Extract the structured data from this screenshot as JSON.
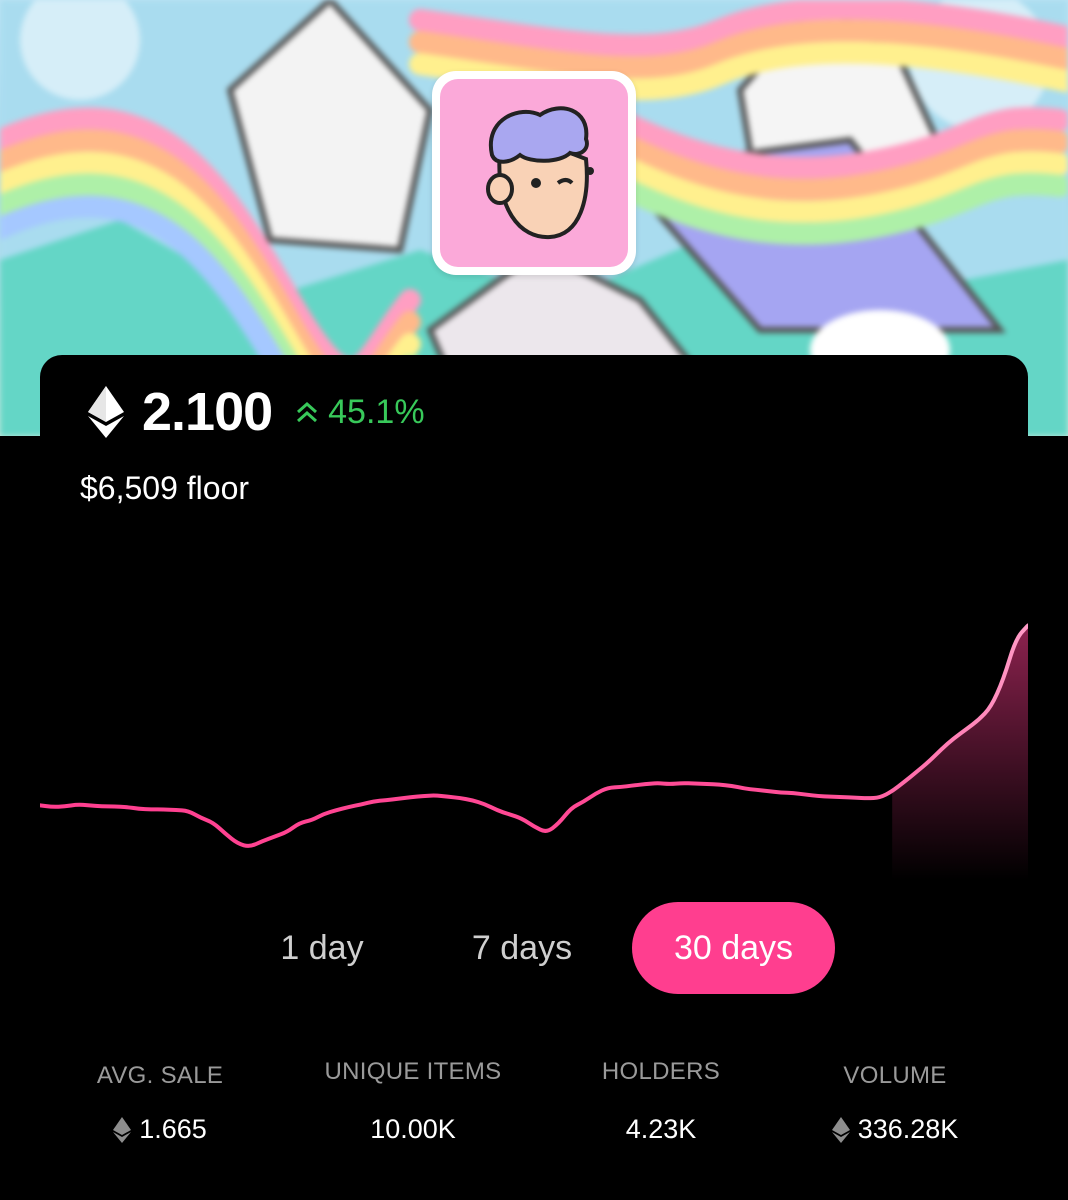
{
  "collection": {
    "avatar": "cartoon-boy-avatar",
    "banner": "rainbow-mountains-banner"
  },
  "price": {
    "currency_icon": "ethereum-icon",
    "floor_eth": "2.100",
    "change_icon": "double-chevron-up-icon",
    "change_pct": "45.1%",
    "floor_usd": "$6,509 floor"
  },
  "colors": {
    "accent": "#ff3e8f",
    "positive": "#38c95a",
    "line": "#ff5ea3"
  },
  "chart_data": {
    "type": "line",
    "title": "",
    "xlabel": "",
    "ylabel": "",
    "x": [
      0,
      1,
      2,
      3,
      4,
      5,
      6,
      7,
      8,
      9,
      10,
      11,
      12,
      13,
      14,
      15,
      16,
      17,
      18,
      19,
      20,
      21,
      22,
      23,
      24,
      25,
      26,
      27,
      28,
      29,
      30,
      31,
      32,
      33,
      34,
      35,
      36,
      37,
      38,
      39,
      40,
      41,
      42,
      43,
      44,
      45,
      46,
      47,
      48,
      49,
      50,
      51,
      52,
      53,
      54,
      55,
      56,
      57,
      58,
      59,
      60,
      61,
      62,
      63,
      64,
      65,
      66,
      67,
      68,
      69,
      70,
      71,
      72,
      73,
      74,
      75,
      76,
      77,
      78,
      79,
      80,
      81,
      82,
      83,
      84,
      85,
      86,
      87,
      88,
      89,
      90
    ],
    "series": [
      {
        "values": [
          1.438,
          1.432,
          1.434,
          1.441,
          1.438,
          1.434,
          1.434,
          1.432,
          1.425,
          1.423,
          1.423,
          1.421,
          1.418,
          1.392,
          1.375,
          1.334,
          1.297,
          1.285,
          1.306,
          1.323,
          1.34,
          1.373,
          1.383,
          1.407,
          1.42,
          1.432,
          1.441,
          1.453,
          1.457,
          1.462,
          1.468,
          1.472,
          1.475,
          1.47,
          1.465,
          1.457,
          1.443,
          1.42,
          1.405,
          1.39,
          1.36,
          1.337,
          1.371,
          1.428,
          1.451,
          1.482,
          1.503,
          1.505,
          1.511,
          1.516,
          1.52,
          1.516,
          1.52,
          1.518,
          1.517,
          1.514,
          1.51,
          1.5,
          1.495,
          1.49,
          1.485,
          1.483,
          1.478,
          1.472,
          1.47,
          1.468,
          1.466,
          1.464,
          1.466,
          1.49,
          1.525,
          1.562,
          1.6,
          1.645,
          1.685,
          1.718,
          1.752,
          1.8,
          1.9,
          2.05,
          2.1
        ],
        "color": "#ff5ea3"
      }
    ],
    "grid": false,
    "legend": "none"
  },
  "tabs": [
    {
      "label": "1 day",
      "active": false
    },
    {
      "label": "7 days",
      "active": false
    },
    {
      "label": "30 days",
      "active": true
    }
  ],
  "stats": [
    {
      "label": "AVG. SALE",
      "value": "1.665",
      "icon": "ethereum-icon"
    },
    {
      "label": "UNIQUE ITEMS",
      "value": "10.00K",
      "icon": ""
    },
    {
      "label": "HOLDERS",
      "value": "4.23K",
      "icon": ""
    },
    {
      "label": "VOLUME",
      "value": "336.28K",
      "icon": "ethereum-icon"
    }
  ]
}
